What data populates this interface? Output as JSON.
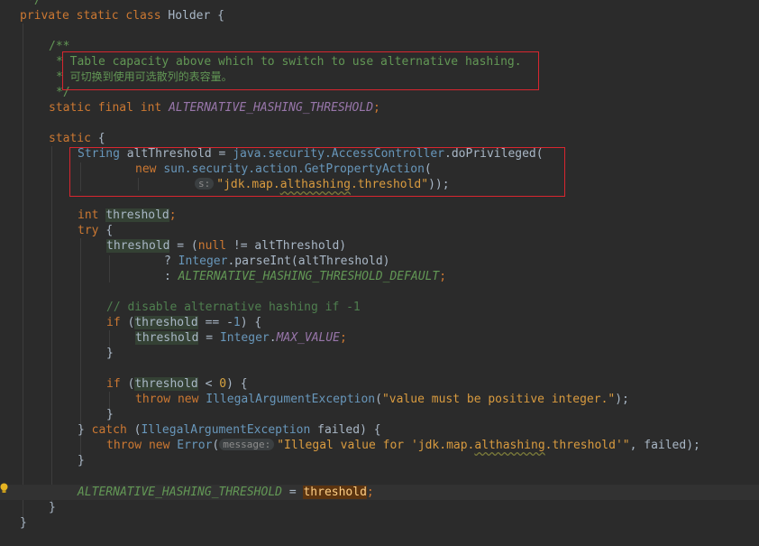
{
  "code": {
    "l0": "*/",
    "l1_kw": "private static class",
    "l1_name": "Holder {",
    "l2_open": "/**",
    "l3_star": "*",
    "l3_text": "Table capacity above which to switch to use alternative hashing.",
    "l4_star": "*",
    "l4_text": "可切换到使用可选散列的表容量。",
    "l5_close": "*/",
    "l6_kw": "static final int",
    "l6_const": "ALTERNATIVE_HASHING_THRESHOLD",
    "l6_end": ";",
    "l7_kw": "static",
    "l7_rest": "{",
    "l8_type": "String",
    "l8_var": "altThreshold =",
    "l8_pkg": "java.security.AccessController",
    "l8_call": ".doPrivileged(",
    "l9_kw": "new",
    "l9_cls": "sun.security.action.GetPropertyAction",
    "l9_paren": "(",
    "l10_hint": "s:",
    "l10_str_a": "\"jdk.map.",
    "l10_str_b": "althashing",
    "l10_str_c": ".threshold\"",
    "l10_end": "));",
    "l11_kw": "int",
    "l11_var": "threshold",
    "l11_end": ";",
    "l12_kw": "try",
    "l12_rest": "{",
    "l13_var": "threshold",
    "l13_eq": "= (",
    "l13_null": "null",
    "l13_rest": "!= altThreshold)",
    "l14_q": "?",
    "l14_cls": "Integer",
    "l14_rest": ".parseInt(altThreshold)",
    "l15_c": ":",
    "l15_const": "ALTERNATIVE_HASHING_THRESHOLD_DEFAULT",
    "l15_end": ";",
    "l16_cmt": "// disable alternative hashing if -1",
    "l17_kw": "if",
    "l17_p": "(",
    "l17_var": "threshold",
    "l17_op": "== -",
    "l17_num": "1",
    "l17_end": ") {",
    "l18_var": "threshold",
    "l18_eq": "=",
    "l18_cls": "Integer",
    "l18_dot": ".",
    "l18_const": "MAX_VALUE",
    "l18_end": ";",
    "l19": "}",
    "l20_kw": "if",
    "l20_p": "(",
    "l20_var": "threshold",
    "l20_op": "<",
    "l20_num": "0",
    "l20_end": ") {",
    "l21_kw": "throw new",
    "l21_cls": "IllegalArgumentException",
    "l21_p": "(",
    "l21_str": "\"value must be positive integer.\"",
    "l21_end": ");",
    "l22": "}",
    "l23_b": "}",
    "l23_kw": "catch",
    "l23_p": "(",
    "l23_cls": "IllegalArgumentException",
    "l23_rest": "failed) {",
    "l24_kw": "throw new",
    "l24_cls": "Error",
    "l24_p": "(",
    "l24_hint": "message:",
    "l24_str_a": "\"Illegal value for 'jdk.map.",
    "l24_str_b": "althashing",
    "l24_str_c": ".threshold'\"",
    "l24_end": ", failed);",
    "l25": "}",
    "l26_const": "ALTERNATIVE_HASHING_THRESHOLD",
    "l26_eq": "=",
    "l26_var": "threshold",
    "l26_end": ";",
    "l27": "}",
    "l28": "}"
  },
  "colors": {
    "background": "#2b2b2b",
    "keyword": "#cc7832",
    "doc_comment": "#629755",
    "annotation_box": "#d8262f",
    "caret_highlight": "#5b3410"
  },
  "icons": {
    "gutter": "lightbulb-icon"
  }
}
